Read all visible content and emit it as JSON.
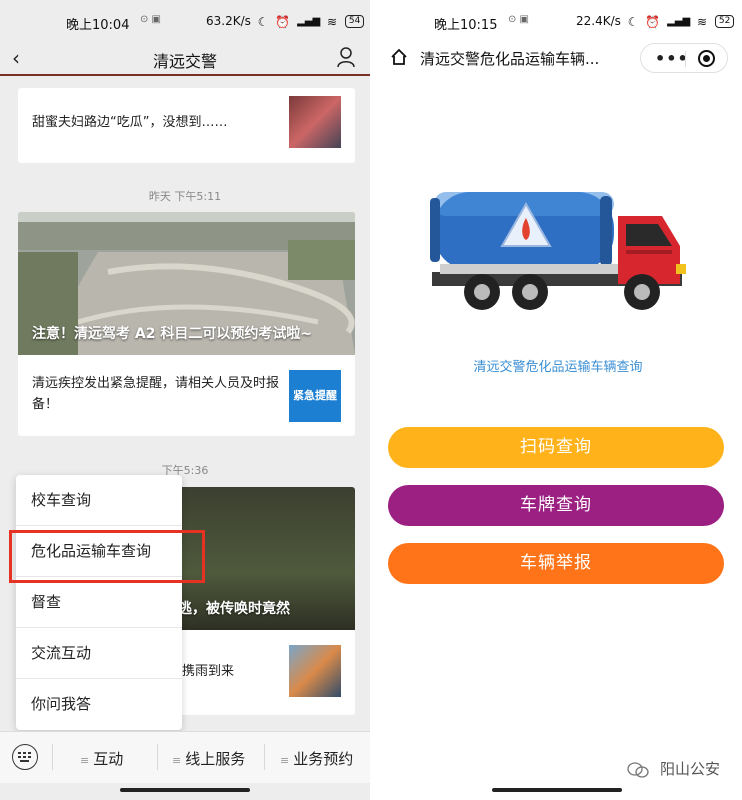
{
  "left": {
    "status": {
      "time": "晚上10:04",
      "speed": "63.2K/s",
      "battery": "54"
    },
    "nav": {
      "title": "清远交警"
    },
    "articles": [
      {
        "title": "甜蜜夫妇路边“吃瓜”，没想到……"
      },
      {
        "caption": "注意！清远驾考 A2 科目二可以预约考试啦~"
      },
      {
        "title": "清远疾控发出紧急提醒，请相关人员及时报备！",
        "thumb_label": "紧急提醒"
      },
      {
        "caption": "逃，被传唤时竟然"
      },
      {
        "title": "携雨到来"
      }
    ],
    "timestamps": [
      "昨天 下午5:11",
      "下午5:36"
    ],
    "menu": [
      "校车查询",
      "危化品运输车查询",
      "督查",
      "交流互动",
      "你问我答"
    ],
    "tabs": [
      "互动",
      "线上服务",
      "业务预约"
    ]
  },
  "right": {
    "status": {
      "time": "晚上10:15",
      "speed": "22.4K/s",
      "battery": "52"
    },
    "nav": {
      "title": "清远交警危化品运输车辆..."
    },
    "subtitle": "清远交警危化品运输车辆查询",
    "buttons": [
      {
        "label": "扫码查询",
        "color": "#ffb21a"
      },
      {
        "label": "车牌查询",
        "color": "#9b2082"
      },
      {
        "label": "车辆举报",
        "color": "#ff7418"
      }
    ]
  },
  "watermark": "阳山公安",
  "colors": {
    "highlight_border": "#e53223",
    "nav_underline": "#7a2f26",
    "subtitle_blue": "#3b8fd3"
  }
}
